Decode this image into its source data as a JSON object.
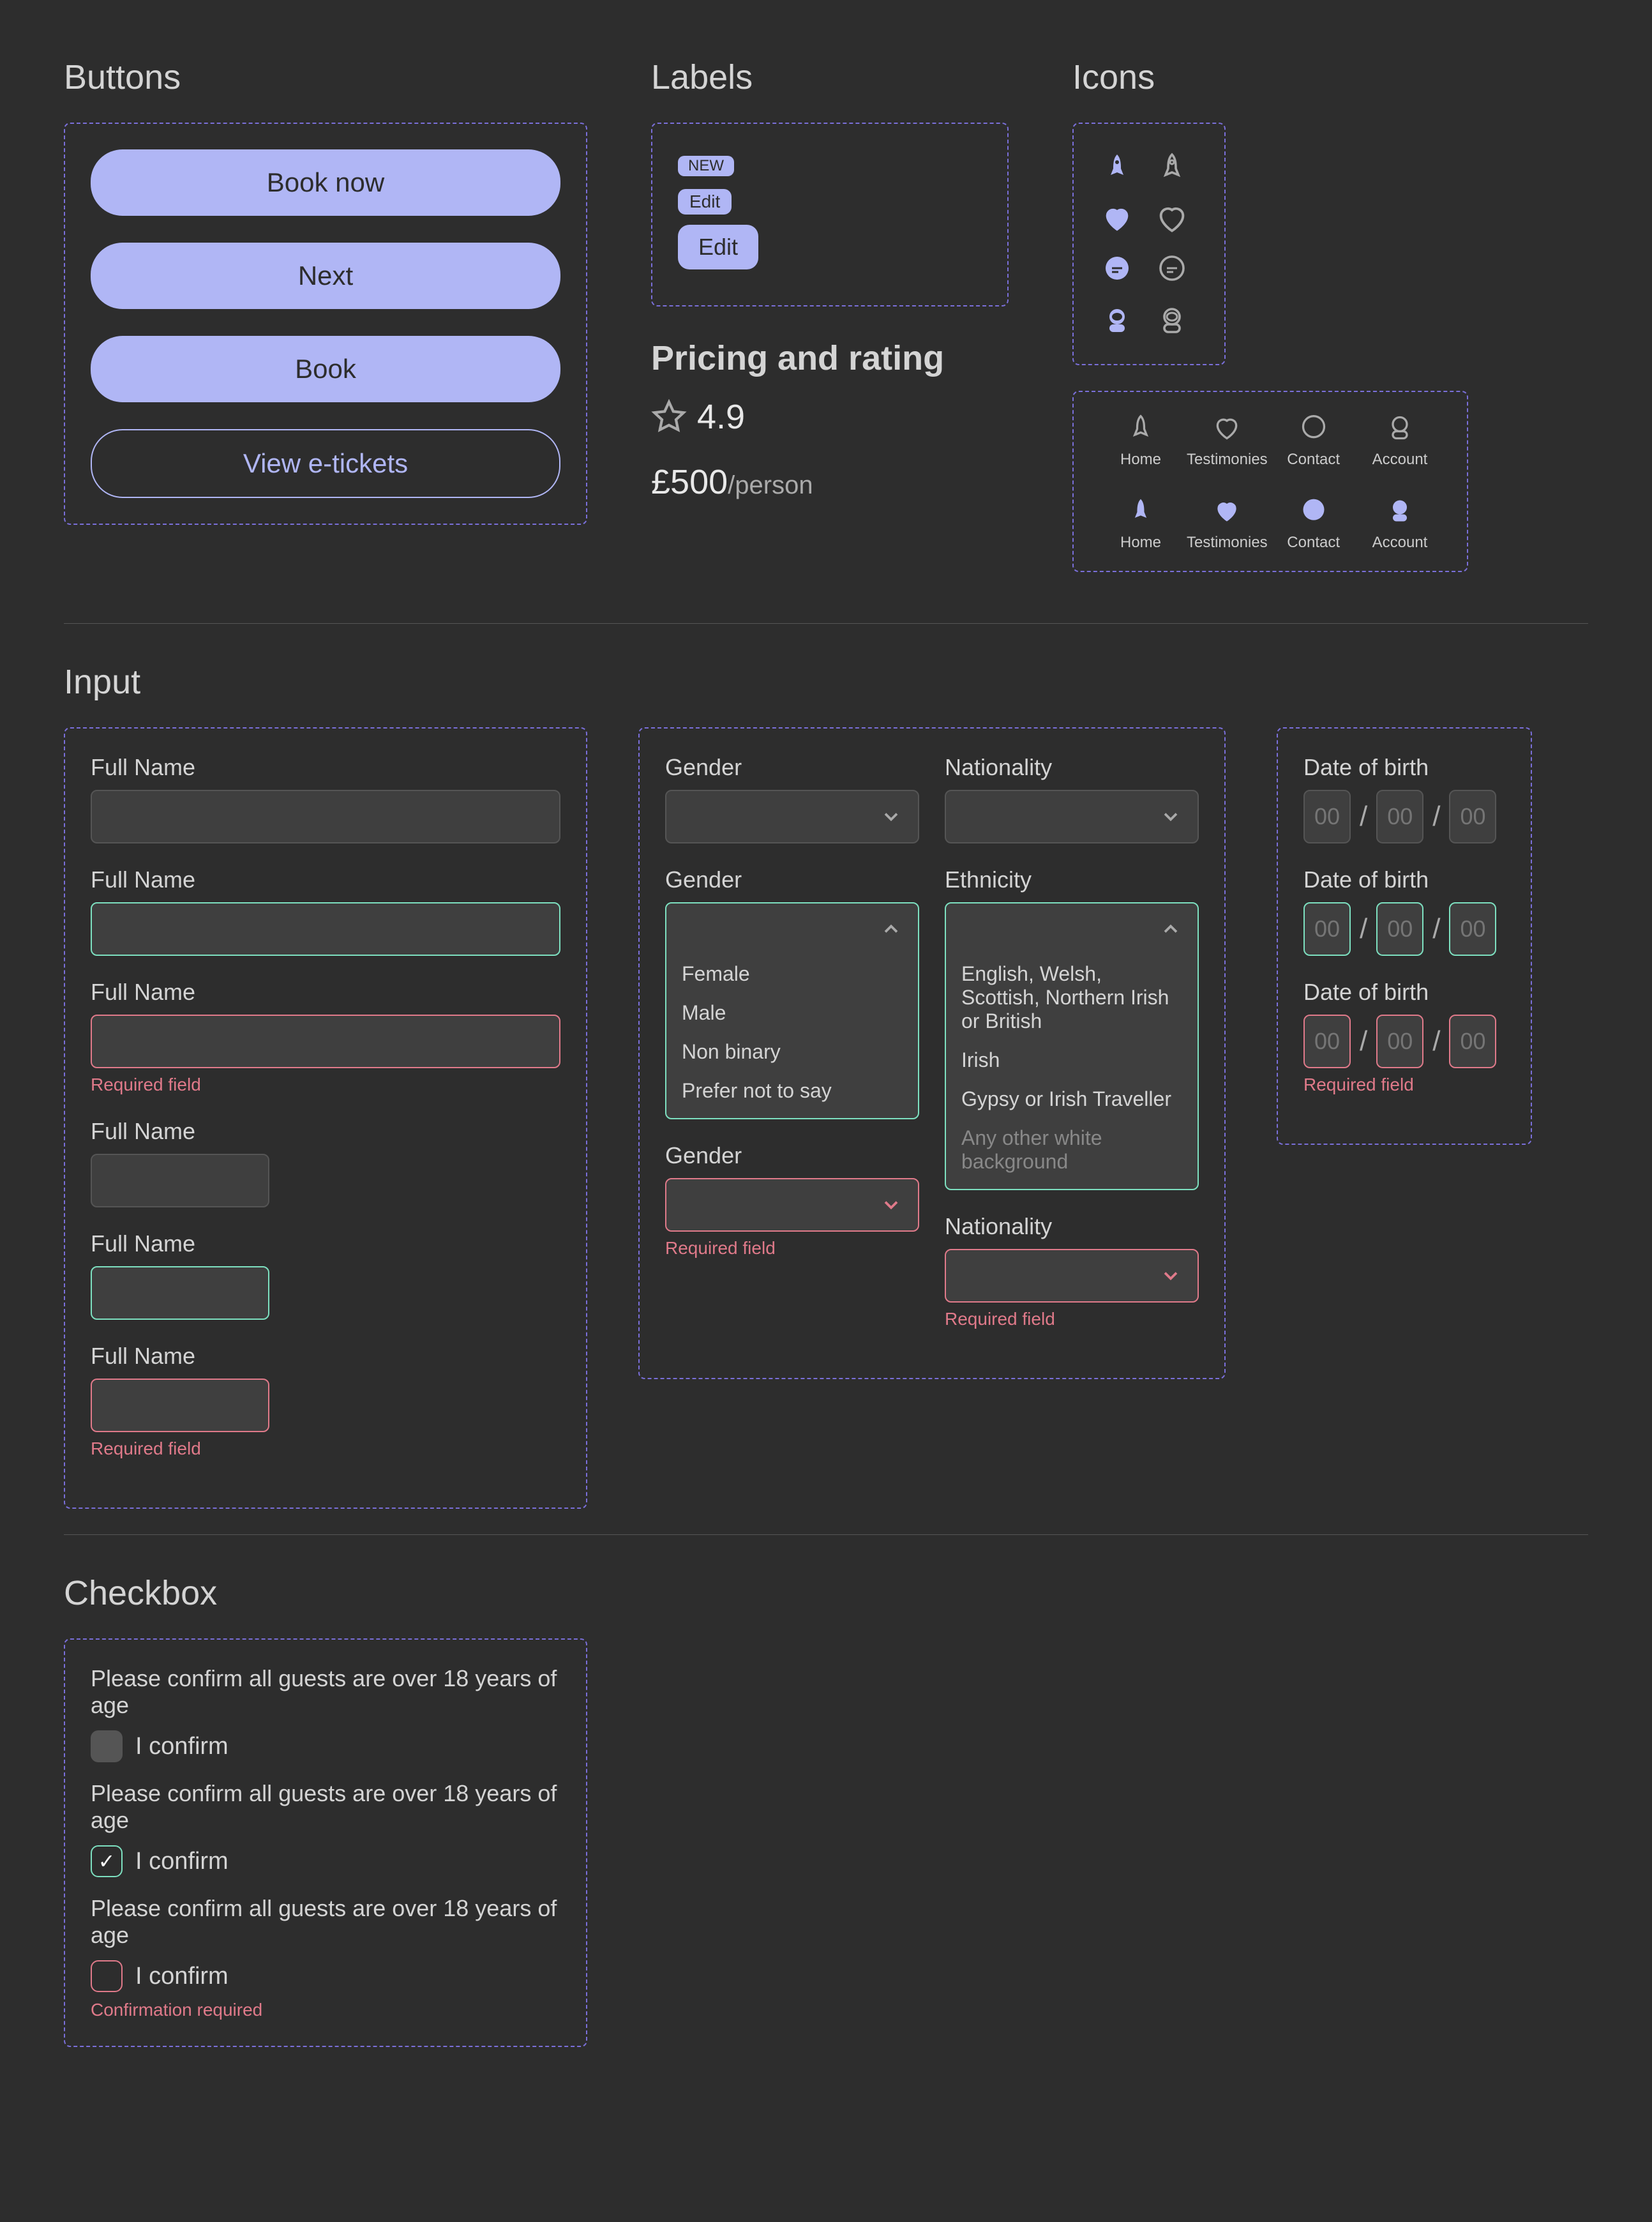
{
  "sections": {
    "buttons": "Buttons",
    "labels": "Labels",
    "icons": "Icons",
    "pricing": "Pricing and rating",
    "input": "Input",
    "checkbox": "Checkbox"
  },
  "buttons": {
    "book_now": "Book now",
    "next": "Next",
    "book": "Book",
    "view_tickets": "View e-tickets"
  },
  "labels": {
    "new": "NEW",
    "edit_small": "Edit",
    "edit": "Edit"
  },
  "rating": {
    "value": "4.9"
  },
  "price": {
    "amount": "£500",
    "suffix": "/person"
  },
  "nav": {
    "home": "Home",
    "testimonies": "Testimonies",
    "contact": "Contact",
    "account": "Account"
  },
  "inputs": {
    "full_name": "Full Name",
    "required": "Required field",
    "gender": "Gender",
    "nationality": "Nationality",
    "ethnicity": "Ethnicity",
    "dob": "Date of birth",
    "placeholder_00": "00",
    "gender_options": {
      "female": "Female",
      "male": "Male",
      "nonbinary": "Non binary",
      "prefnot": "Prefer not to say"
    },
    "ethnicity_options": {
      "eng": "English, Welsh, Scottish, Northern Irish or British",
      "irish": "Irish",
      "gypsy": "Gypsy or Irish Traveller",
      "other": "Any other white background"
    }
  },
  "checkbox": {
    "prompt": "Please confirm all guests are over 18 years of age",
    "confirm": "I confirm",
    "required": "Confirmation required"
  }
}
